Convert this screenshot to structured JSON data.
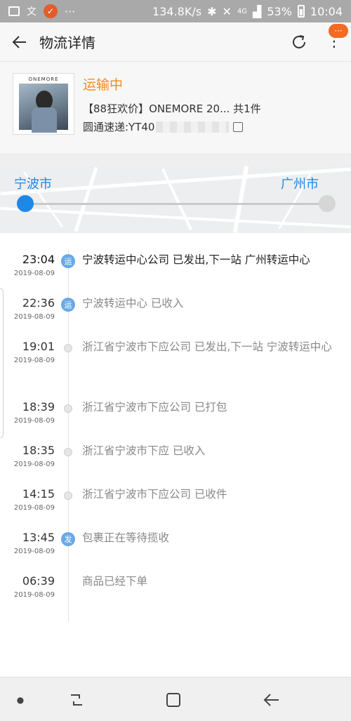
{
  "status_bar": {
    "speed": "134.8K/s",
    "network": "4G",
    "battery": "53%",
    "time": "10:04",
    "notif_badge": "✓",
    "dots": "···"
  },
  "header": {
    "title": "物流详情",
    "back_icon": "arrow-left-icon",
    "refresh_icon": "refresh-icon",
    "more_icon": "more-vertical-icon",
    "badge": "···"
  },
  "order": {
    "thumb_brand": "ONEMORE",
    "status": "运输中",
    "product": "【88狂欢价】ONEMORE 20... 共1件",
    "carrier_prefix": "圆通速递:YT40"
  },
  "map": {
    "from_city": "宁波市",
    "to_city": "广州市"
  },
  "events": [
    {
      "time": "23:04",
      "date": "2019-08-09",
      "node": "运",
      "text": "宁波转运中心公司 已发出,下一站 广州转运中心"
    },
    {
      "time": "22:36",
      "date": "2019-08-09",
      "node": "运",
      "text": "宁波转运中心 已收入"
    },
    {
      "time": "19:01",
      "date": "2019-08-09",
      "node": "",
      "text": "浙江省宁波市下应公司 已发出,下一站 宁波转运中心"
    },
    {
      "time": "18:39",
      "date": "2019-08-09",
      "node": "",
      "text": "浙江省宁波市下应公司 已打包"
    },
    {
      "time": "18:35",
      "date": "2019-08-09",
      "node": "",
      "text": "浙江省宁波市下应 已收入"
    },
    {
      "time": "14:15",
      "date": "2019-08-09",
      "node": "",
      "text": "浙江省宁波市下应公司 已收件"
    },
    {
      "time": "13:45",
      "date": "2019-08-09",
      "node": "发",
      "text": "包裹正在等待揽收"
    },
    {
      "time": "06:39",
      "date": "2019-08-09",
      "node": "",
      "text": "商品已经下单"
    }
  ],
  "colors": {
    "accent_orange": "#f08c1e",
    "city_blue": "#1e88e5",
    "node_blue": "#69a9e6"
  }
}
